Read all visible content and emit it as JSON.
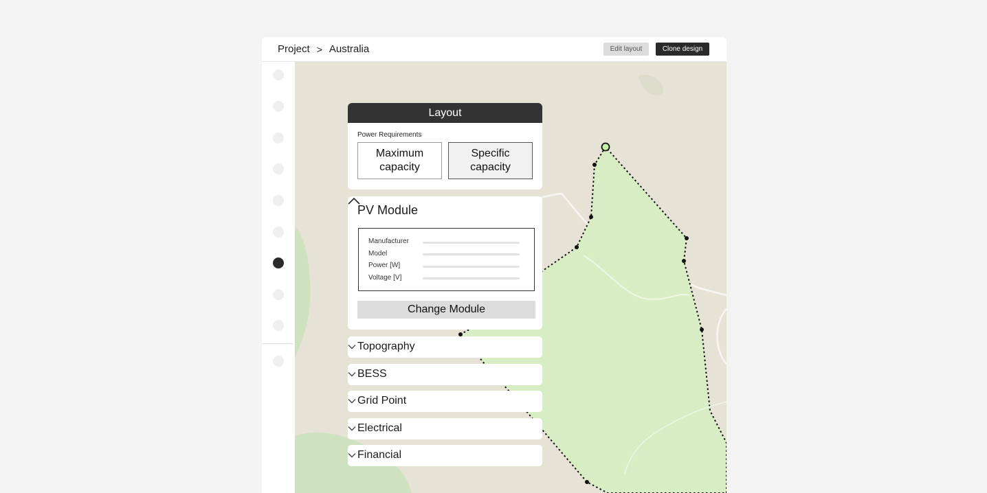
{
  "header": {
    "breadcrumb": [
      "Project",
      "Australia"
    ],
    "breadcrumb_separator": ">",
    "edit_layout_label": "Edit layout",
    "clone_design_label": "Clone design"
  },
  "sidebar": {
    "item_count": 10,
    "active_index": 6,
    "active_color": "#2b2b2b",
    "inactive_color": "#efefef"
  },
  "layout_panel": {
    "title": "Layout",
    "power_requirements_label": "Power Requirements",
    "options": [
      {
        "label": "Maximum capacity",
        "selected": false
      },
      {
        "label": "Specific capacity",
        "selected": true
      }
    ]
  },
  "pv_module": {
    "title": "PV Module",
    "expanded": true,
    "fields": [
      "Manufacturer",
      "Model",
      "Power [W]",
      "Voltage [V]"
    ],
    "change_button_label": "Change Module"
  },
  "sections": [
    {
      "label": "Topography",
      "expanded": false
    },
    {
      "label": "BESS",
      "expanded": false
    },
    {
      "label": "Grid Point",
      "expanded": false
    },
    {
      "label": "Electrical",
      "expanded": false
    },
    {
      "label": "Financial",
      "expanded": false
    }
  ],
  "map": {
    "terrain_color": "#e6e3d6",
    "forest_color": "#cfe2c0",
    "site_fill_color": "#d8edc4",
    "boundary_color": "#111111",
    "vertex_highlight_color": "#c9f0a8"
  },
  "icons": {
    "expand": "chevron-down-icon",
    "collapse": "chevron-up-icon",
    "separator": "chevron-right-icon"
  }
}
